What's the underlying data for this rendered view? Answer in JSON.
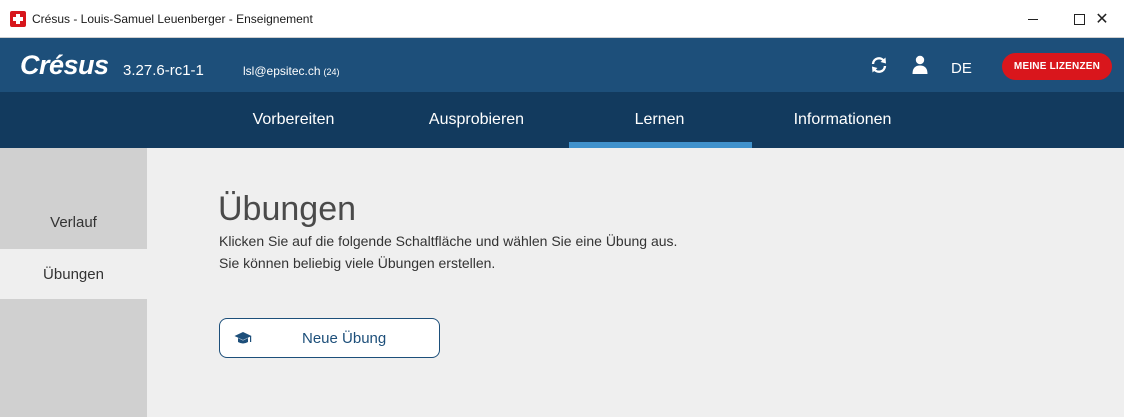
{
  "window": {
    "title": "Crésus - Louis-Samuel Leuenberger - Enseignement",
    "controls": [
      "minimize-icon",
      "maximize-icon",
      "close-icon"
    ],
    "close_symbol": "✕"
  },
  "header": {
    "logo": "Crésus",
    "version": "3.27.6-rc1-1",
    "email": "lsl@epsitec.ch",
    "count": "(24)",
    "language": "DE",
    "licenses_button": "MEINE LIZENZEN",
    "icons": [
      "sync-icon",
      "user-icon"
    ]
  },
  "nav": {
    "tabs": [
      {
        "label": "Vorbereiten"
      },
      {
        "label": "Ausprobieren"
      },
      {
        "label": "Lernen",
        "active": true
      },
      {
        "label": "Informationen"
      }
    ]
  },
  "sidebar": {
    "items": [
      {
        "label": "Verlauf"
      },
      {
        "label": "Übungen",
        "selected": true
      }
    ]
  },
  "main": {
    "title": "Übungen",
    "description_line1": "Klicken Sie auf die folgende Schaltfläche und wählen Sie eine Übung aus.",
    "description_line2": "Sie können beliebig viele Übungen erstellen.",
    "new_button_label": "Neue Übung",
    "new_button_icon": "graduation-cap-icon"
  },
  "colors": {
    "header_bg": "#1d4f7a",
    "nav_bg": "#123a5e",
    "active_tab": "#3f91cc",
    "license_red": "#d9161c"
  }
}
